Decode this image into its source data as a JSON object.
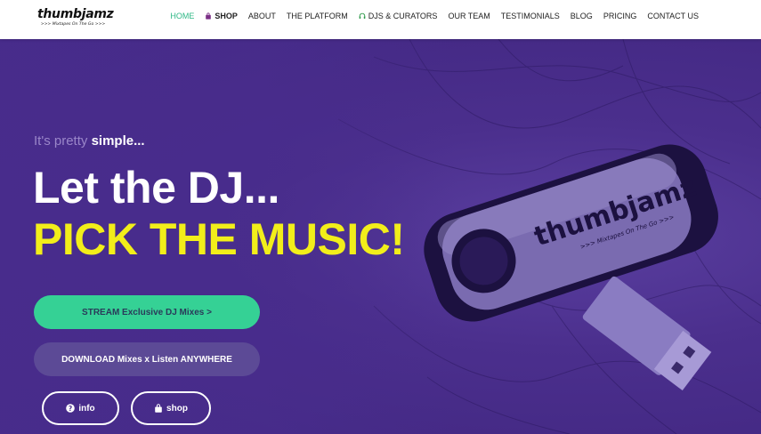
{
  "header": {
    "logo": {
      "word": "thumbjamz",
      "tagline": ">>> Mixtapes On The Go >>>"
    },
    "nav": [
      {
        "label": "HOME",
        "active": true
      },
      {
        "label": "SHOP",
        "icon": "shopping-bag-icon"
      },
      {
        "label": "ABOUT"
      },
      {
        "label": "THE PLATFORM"
      },
      {
        "label": "DJS & CURATORS",
        "icon": "headphones-icon"
      },
      {
        "label": "OUR TEAM"
      },
      {
        "label": "TESTIMONIALS"
      },
      {
        "label": "BLOG"
      },
      {
        "label": "PRICING"
      },
      {
        "label": "CONTACT US"
      }
    ]
  },
  "hero": {
    "kicker_prefix": "It's pretty ",
    "kicker_emphasis": "simple...",
    "headline": "Let the DJ...",
    "subhead": "PICK THE MUSIC!",
    "stream_label": "STREAM Exclusive DJ Mixes >",
    "download_label": "DOWNLOAD Mixes x Listen ANYWHERE",
    "info_label": "info",
    "shop_label": "shop",
    "usb_brand": "thumbjamz",
    "usb_tagline": ">>> Mixtapes On The Go >>>"
  },
  "colors": {
    "accent_green": "#35d195",
    "nav_active": "#2fb886",
    "headline_yellow": "#f2ee1a",
    "hero_purple": "#4a2f8c",
    "button_purple": "#5c4a96"
  }
}
